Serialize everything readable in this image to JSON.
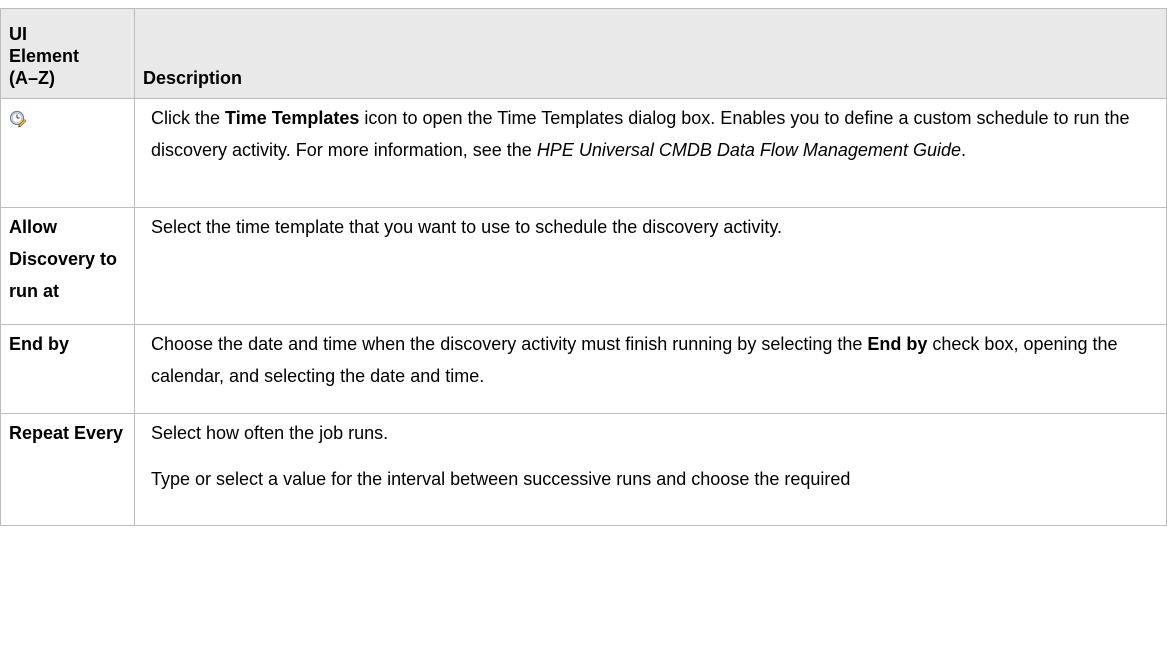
{
  "table": {
    "header": {
      "col1_line1": "UI",
      "col1_line2": "Element",
      "col1_line3": "(A–Z)",
      "col2": "Description"
    },
    "rows": [
      {
        "element_icon": "time-templates-icon",
        "desc_part1": "Click the ",
        "desc_bold": "Time Templates",
        "desc_part2": " icon to open the Time Templates dialog box. Enables you to define a custom schedule to run the discovery activity. For more information, see the ",
        "desc_italic": "HPE Universal CMDB Data Flow Management Guide",
        "desc_part3": "."
      },
      {
        "element": "Allow Discovery to run at",
        "description": "Select the time template that you want to use to schedule the discovery activity."
      },
      {
        "element": "End by",
        "desc_part1": "Choose the date and time when the discovery activity must finish running by selecting the ",
        "desc_bold": "End by",
        "desc_part2": " check box, opening the calendar, and selecting the date and time."
      },
      {
        "element": "Repeat Every",
        "desc_para1": "Select how often the job runs.",
        "desc_para2": "Type or select a value for the interval between successive runs and choose the required"
      }
    ]
  },
  "colors": {
    "header_bg": "#e9e9e9",
    "border": "#bdbdbd",
    "text": "#000000"
  }
}
